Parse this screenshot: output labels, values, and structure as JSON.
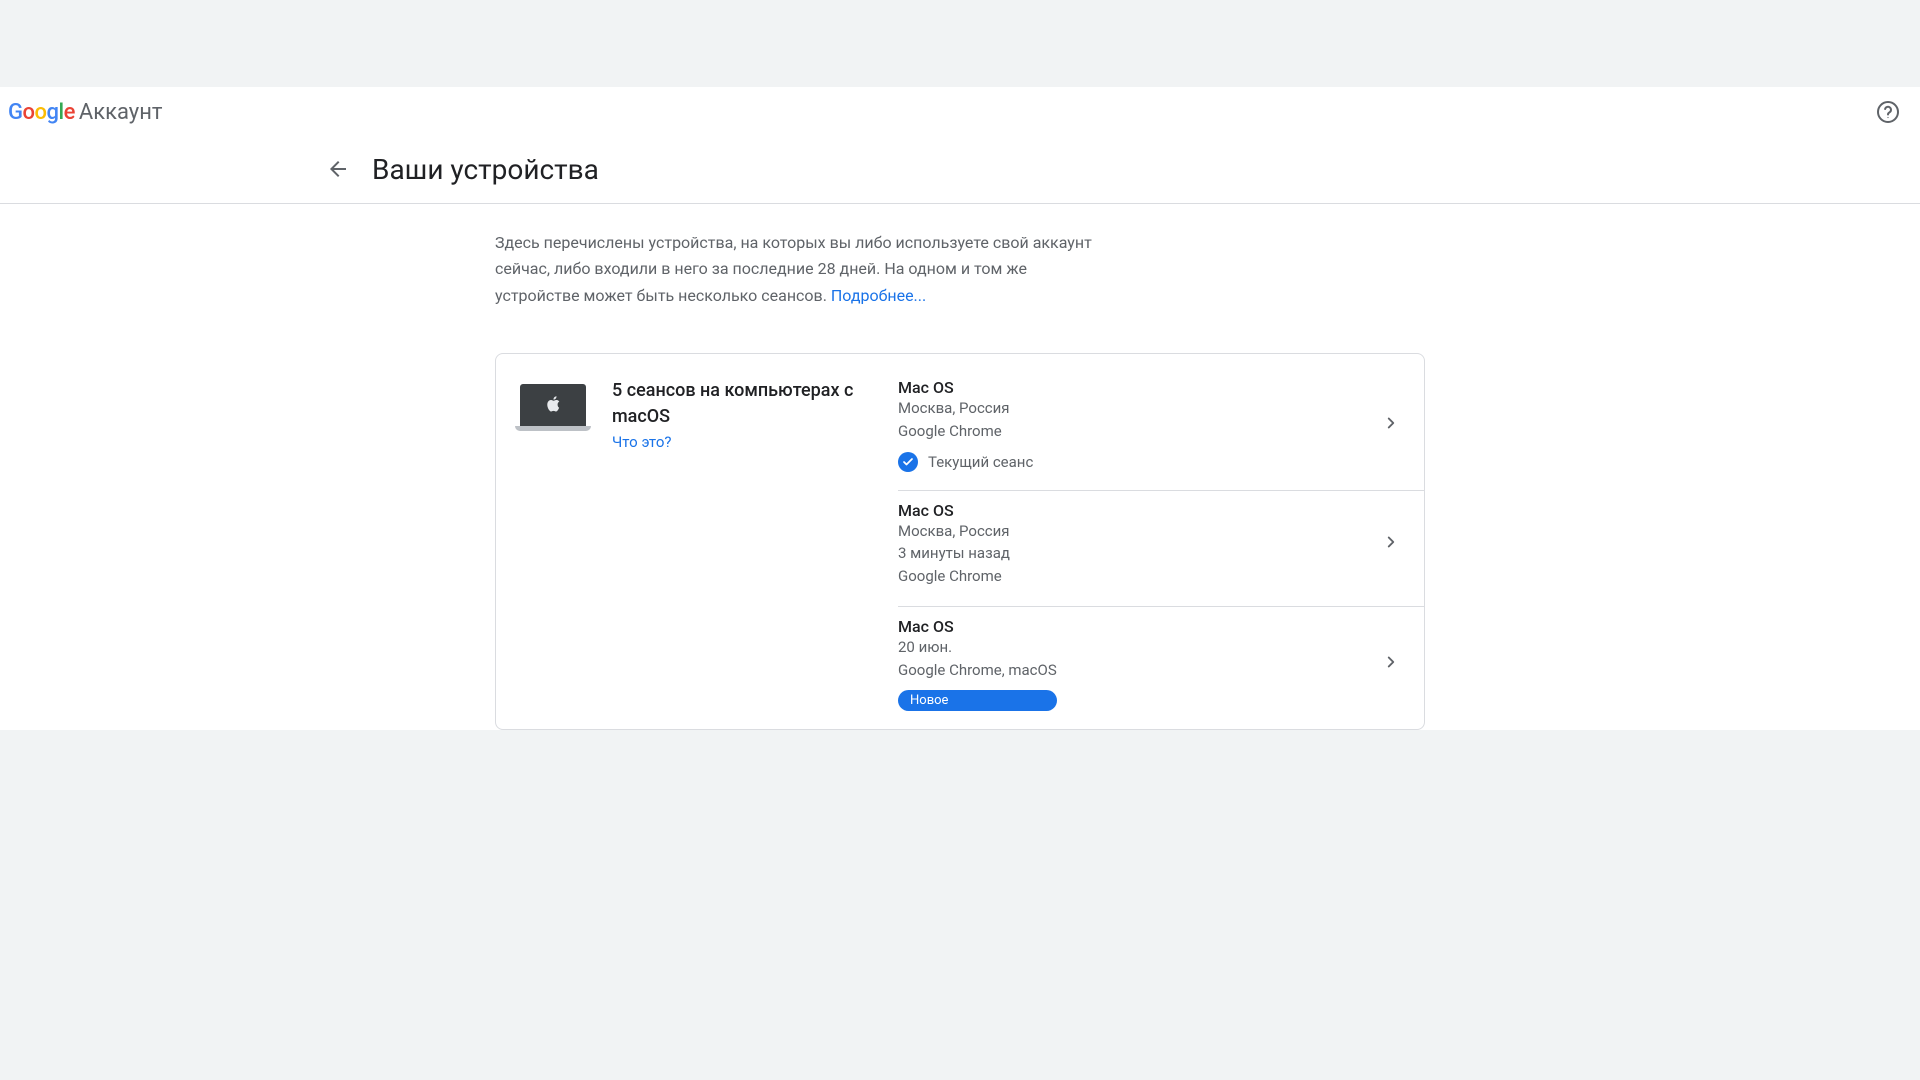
{
  "header": {
    "brand_word": "Google",
    "account_label": "Аккаунт"
  },
  "page": {
    "title": "Ваши устройства",
    "intro_text": "Здесь перечислены устройства, на которых вы либо используете свой аккаунт сейчас, либо входили в него за последние 28 дней. На одном и том же устройстве может быть несколько сеансов. ",
    "learn_more": "Подробнее..."
  },
  "device_group": {
    "title": "5 сеансов на компьютерах с macOS",
    "what_is_this": "Что это?",
    "icon": "apple-laptop"
  },
  "sessions": [
    {
      "os": "Mac OS",
      "location": "Москва, Россия",
      "app": "Google Chrome",
      "current_session_label": "Текущий сеанс",
      "is_current": true
    },
    {
      "os": "Mac OS",
      "location": "Москва, Россия",
      "time": "3 минуты назад",
      "app": "Google Chrome"
    },
    {
      "os": "Mac OS",
      "date": "20 июн.",
      "app": "Google Chrome, macOS",
      "new_badge": "Новое",
      "is_new": true
    }
  ]
}
